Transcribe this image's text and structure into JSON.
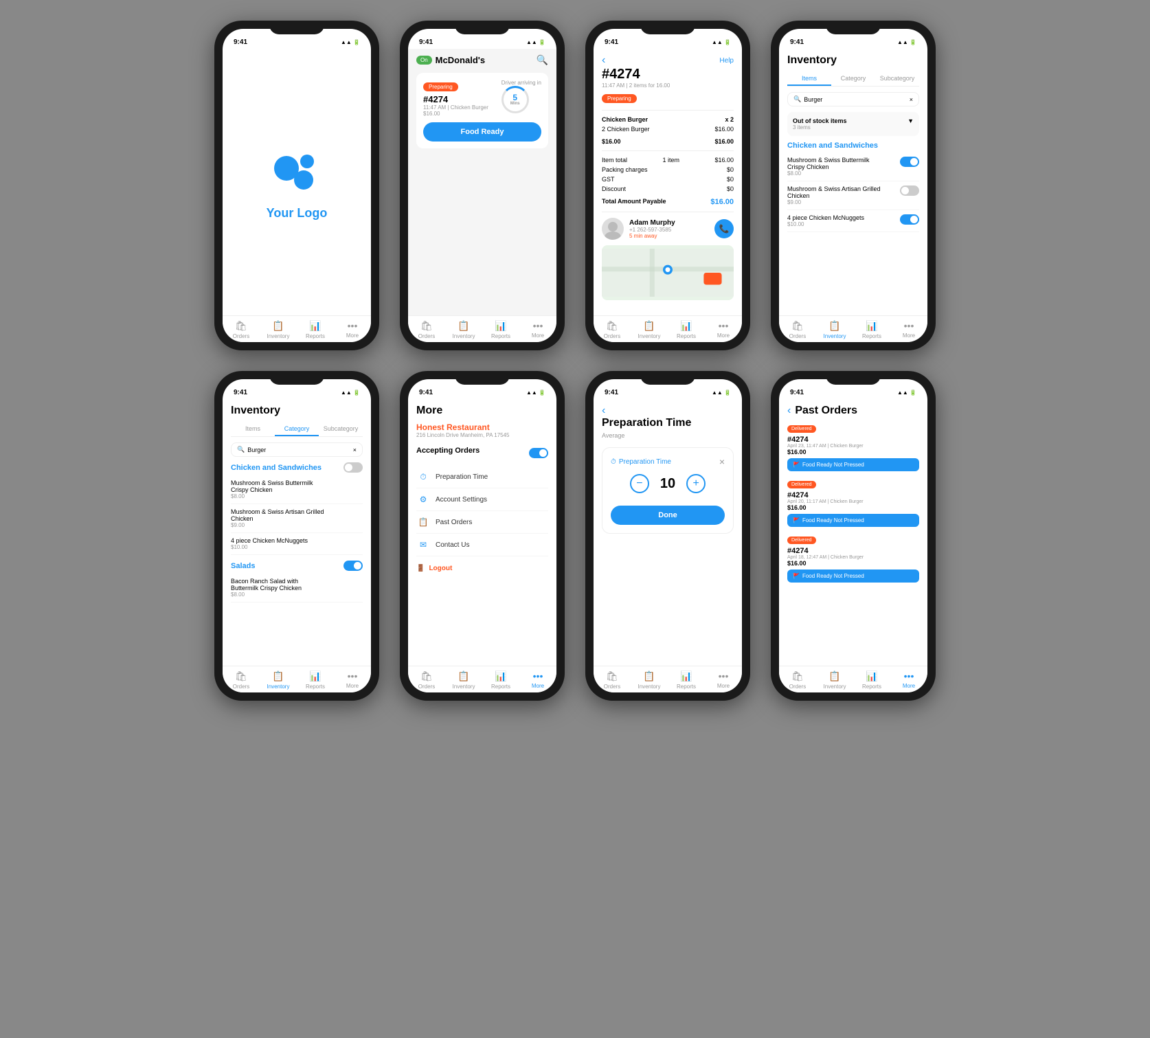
{
  "statusBar": {
    "time": "9:41",
    "icons": "▲ ▲ ▲ 🔋"
  },
  "phones": [
    {
      "id": "logo",
      "screen": "logo",
      "logo": {
        "text": "Your Logo",
        "color": "#2196F3"
      },
      "nav": {
        "items": [
          {
            "label": "Orders",
            "icon": "🛍",
            "active": false
          },
          {
            "label": "Inventory",
            "icon": "📋",
            "active": false
          },
          {
            "label": "Reports",
            "icon": "📊",
            "active": false
          },
          {
            "label": "More",
            "icon": "•••",
            "active": false
          }
        ]
      }
    },
    {
      "id": "orders",
      "screen": "orders",
      "header": {
        "status": "On",
        "restaurantName": "McDonald's",
        "searchIcon": "🔍"
      },
      "orderCard": {
        "badge": "Preparing",
        "driverText": "Driver arriving in",
        "orderId": "#4274",
        "time": "11:47 AM",
        "item": "Chicken Burger",
        "price": "$16.00",
        "timerValue": "5",
        "timerLabel": "Mins",
        "foodReadyBtn": "Food Ready"
      },
      "nav": {
        "items": [
          {
            "label": "Orders",
            "icon": "🛍",
            "active": false
          },
          {
            "label": "Inventory",
            "icon": "📋",
            "active": false
          },
          {
            "label": "Reports",
            "icon": "📊",
            "active": false
          },
          {
            "label": "More",
            "icon": "•••",
            "active": false
          }
        ]
      }
    },
    {
      "id": "orderDetail",
      "screen": "orderDetail",
      "order": {
        "id": "#4274",
        "meta": "11:47 AM | 2 items for 16.00",
        "badge": "Preparing",
        "helpLabel": "Help",
        "item": "Chicken Burger",
        "qty": "x 2",
        "itemDesc": "2 Chicken Burger",
        "itemTotal": "$16.00",
        "billTotal": "$16.00",
        "itemTotalLabel": "Item total",
        "itemCount": "1 item",
        "itemTotalVal": "$16.00",
        "packingLabel": "Packing charges",
        "packingVal": "$0",
        "gstLabel": "GST",
        "gstVal": "$0",
        "discountLabel": "Discount",
        "discountVal": "$0",
        "totalLabel": "Total Amount Payable",
        "totalVal": "$16.00",
        "driver": {
          "name": "Adam Murphy",
          "phone": "+1 262-597-3585",
          "away": "5 min away"
        }
      },
      "nav": {
        "items": [
          {
            "label": "Orders",
            "icon": "🛍",
            "active": false
          },
          {
            "label": "Inventory",
            "icon": "📋",
            "active": false
          },
          {
            "label": "Reports",
            "icon": "📊",
            "active": false
          },
          {
            "label": "More",
            "icon": "•••",
            "active": false
          }
        ]
      }
    },
    {
      "id": "inventoryItems",
      "screen": "inventoryItems",
      "title": "Inventory",
      "tabs": [
        "Items",
        "Category",
        "Subcategory"
      ],
      "activeTab": 0,
      "search": {
        "placeholder": "Burger",
        "clearIcon": "×"
      },
      "outOfStock": {
        "label": "Out of stock items",
        "count": "3 items"
      },
      "category": {
        "name": "Chicken and Sandwiches",
        "items": [
          {
            "name": "Mushroom & Swiss Buttermilk Crispy Chicken",
            "price": "$8.00",
            "on": true
          },
          {
            "name": "Mushroom & Swiss Artisan Grilled Chicken",
            "price": "$9.00",
            "on": false
          },
          {
            "name": "4 piece Chicken McNuggets",
            "price": "$10.00",
            "on": true
          }
        ]
      },
      "nav": {
        "items": [
          {
            "label": "Orders",
            "icon": "🛍",
            "active": false
          },
          {
            "label": "Inventory",
            "icon": "📋",
            "active": true
          },
          {
            "label": "Reports",
            "icon": "📊",
            "active": false
          },
          {
            "label": "More",
            "icon": "•••",
            "active": false
          }
        ]
      }
    },
    {
      "id": "inventoryCategory",
      "screen": "inventoryCategory",
      "title": "Inventory",
      "tabs": [
        "Items",
        "Category",
        "Subcategory"
      ],
      "activeTab": 1,
      "search": {
        "placeholder": "Burger",
        "clearIcon": "×"
      },
      "categories": [
        {
          "name": "Chicken and Sandwiches",
          "on": false,
          "items": [
            {
              "name": "Mushroom & Swiss Buttermilk Crispy Chicken",
              "price": "$8.00"
            },
            {
              "name": "Mushroom & Swiss Artisan Grilled Chicken",
              "price": "$9.00"
            },
            {
              "name": "4 piece Chicken McNuggets",
              "price": "$10.00"
            }
          ]
        },
        {
          "name": "Salads",
          "on": true,
          "items": [
            {
              "name": "Bacon Ranch Salad with Buttermilk Crispy Chicken",
              "price": "$8.00"
            }
          ]
        }
      ],
      "nav": {
        "items": [
          {
            "label": "Orders",
            "icon": "🛍",
            "active": false
          },
          {
            "label": "Inventory",
            "icon": "📋",
            "active": true
          },
          {
            "label": "Reports",
            "icon": "📊",
            "active": false
          },
          {
            "label": "More",
            "icon": "•••",
            "active": false
          }
        ]
      }
    },
    {
      "id": "more",
      "screen": "more",
      "title": "More",
      "restaurant": {
        "name": "Honest Restaurant",
        "address": "216 Lincoln Drive Manheim, PA 17545"
      },
      "acceptingOrders": {
        "label": "Accepting Orders",
        "on": true
      },
      "menuItems": [
        {
          "icon": "⏱",
          "label": "Preparation Time"
        },
        {
          "icon": "⚙",
          "label": "Account Settings"
        },
        {
          "icon": "📋",
          "label": "Past Orders"
        },
        {
          "icon": "✉",
          "label": "Contact Us"
        }
      ],
      "logoutLabel": "Logout",
      "nav": {
        "items": [
          {
            "label": "Orders",
            "icon": "🛍",
            "active": false
          },
          {
            "label": "Inventory",
            "icon": "📋",
            "active": false
          },
          {
            "label": "Reports",
            "icon": "📊",
            "active": false
          },
          {
            "label": "More",
            "icon": "•••",
            "active": true
          }
        ]
      }
    },
    {
      "id": "prepTime",
      "screen": "prepTime",
      "title": "Preparation Time",
      "subtitle": "Average",
      "modal": {
        "label": "Preparation Time",
        "value": 10,
        "decrementIcon": "−",
        "incrementIcon": "+",
        "closeIcon": "×",
        "doneBtn": "Done"
      },
      "nav": {
        "items": [
          {
            "label": "Orders",
            "icon": "🛍",
            "active": false
          },
          {
            "label": "Inventory",
            "icon": "📋",
            "active": false
          },
          {
            "label": "Reports",
            "icon": "📊",
            "active": false
          },
          {
            "label": "More",
            "icon": "•••",
            "active": false
          }
        ]
      }
    },
    {
      "id": "pastOrders",
      "screen": "pastOrders",
      "backIcon": "‹",
      "title": "Past Orders",
      "orders": [
        {
          "badge": "Delivered",
          "id": "#4274",
          "date": "April 23, 11:47 AM | Chicken Burger",
          "price": "$16.00",
          "btnLabel": "🚩 Food Ready Not Pressed"
        },
        {
          "badge": "Delivered",
          "id": "#4274",
          "date": "April 20, 11:17 AM | Chicken Burger",
          "price": "$16.00",
          "btnLabel": "🚩 Food Ready Not Pressed"
        },
        {
          "badge": "Delivered",
          "id": "#4274",
          "date": "April 18, 12:47 AM | Chicken Burger",
          "price": "$16.00",
          "btnLabel": "🚩 Food Ready Not Pressed"
        }
      ],
      "nav": {
        "items": [
          {
            "label": "Orders",
            "icon": "🛍",
            "active": false
          },
          {
            "label": "Inventory",
            "icon": "📋",
            "active": false
          },
          {
            "label": "Reports",
            "icon": "📊",
            "active": false
          },
          {
            "label": "More",
            "icon": "•••",
            "active": true
          }
        ]
      }
    }
  ]
}
